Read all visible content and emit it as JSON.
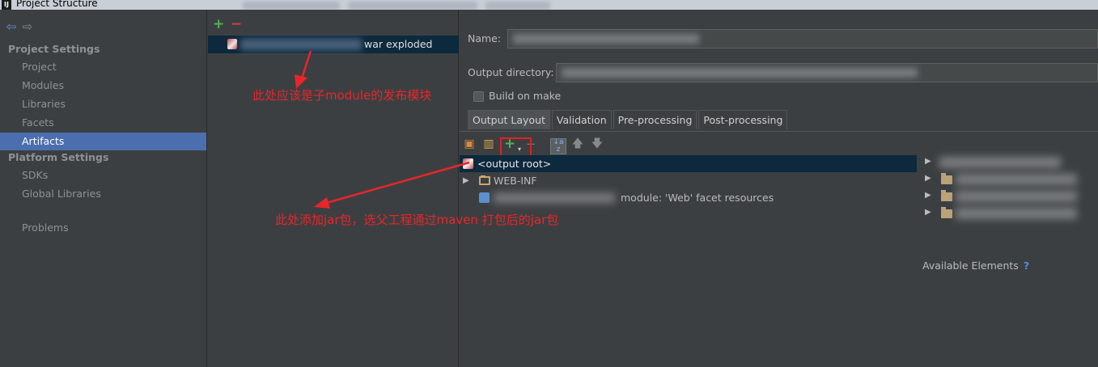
{
  "window": {
    "title": "Project Structure",
    "app_icon": "IJ"
  },
  "sidebar": {
    "project_settings_header": "Project Settings",
    "project_settings_items": [
      {
        "label": "Project",
        "selected": false
      },
      {
        "label": "Modules",
        "selected": false
      },
      {
        "label": "Libraries",
        "selected": false
      },
      {
        "label": "Facets",
        "selected": false
      },
      {
        "label": "Artifacts",
        "selected": true
      }
    ],
    "platform_settings_header": "Platform Settings",
    "platform_settings_items": [
      {
        "label": "SDKs"
      },
      {
        "label": "Global Libraries"
      }
    ],
    "problems_label": "Problems"
  },
  "artifacts_list": {
    "add_glyph": "+",
    "remove_glyph": "−",
    "items": [
      {
        "label": "war exploded",
        "selected": true
      }
    ]
  },
  "artifact_editor": {
    "name_label": "Name:",
    "output_directory_label": "Output directory:",
    "build_on_make_label": "Build on make",
    "build_on_make_checked": false,
    "tabs": [
      {
        "label": "Output Layout",
        "active": true
      },
      {
        "label": "Validation",
        "active": false
      },
      {
        "label": "Pre-processing",
        "active": false
      },
      {
        "label": "Post-processing",
        "active": false
      }
    ],
    "layout_tree": [
      {
        "label": "<output root>",
        "icon": "archive-icon",
        "selected": true
      },
      {
        "label": "WEB-INF",
        "icon": "folder-icon",
        "selected": false
      },
      {
        "label": "module: 'Web' facet resources",
        "icon": "web-facet-icon",
        "selected": false
      }
    ],
    "available_elements_label": "Available Elements",
    "available_elements_help": "?"
  },
  "annotations": {
    "submodule_note": "此处应该是子module的发布模块",
    "jar_note": "此处添加jar包，选父工程通过maven 打包后的jar包"
  },
  "colors": {
    "background": "#3c3f41",
    "selection": "#4b6eaf",
    "tree_selection": "#0d293e",
    "annotation_red": "#e8262a",
    "add_green": "#4fb34f"
  }
}
